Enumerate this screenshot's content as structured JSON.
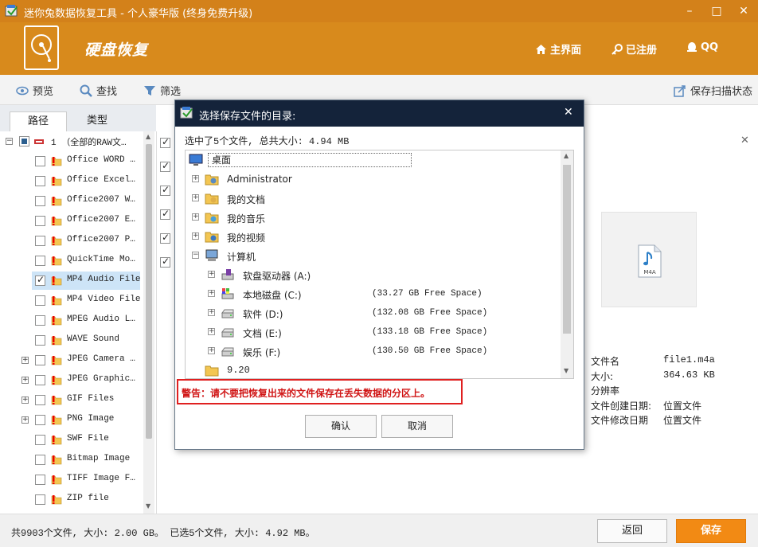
{
  "window": {
    "title": "迷你兔数据恢复工具 - 个人豪华版 (终身免费升级)",
    "minimize": "–",
    "maximize": "□",
    "close": "✕"
  },
  "header": {
    "app_title": "硬盘恢复",
    "nav": {
      "home": "主界面",
      "registered": "已注册",
      "qq": "QQ"
    }
  },
  "toolbar": {
    "preview": "预览",
    "find": "查找",
    "filter": "筛选",
    "save_scan": "保存扫描状态"
  },
  "left_tabs": {
    "path": "路径",
    "type": "类型"
  },
  "tree": {
    "root": "1 （全部的RAW文…",
    "items": [
      {
        "label": "Office WORD …",
        "checked": false,
        "expandable": false
      },
      {
        "label": "Office Excel…",
        "checked": false,
        "expandable": false
      },
      {
        "label": "Office2007 W…",
        "checked": false,
        "expandable": false
      },
      {
        "label": "Office2007 E…",
        "checked": false,
        "expandable": false
      },
      {
        "label": "Office2007 P…",
        "checked": false,
        "expandable": false
      },
      {
        "label": "QuickTime Mo…",
        "checked": false,
        "expandable": false
      },
      {
        "label": "MP4 Audio File",
        "checked": true,
        "expandable": false,
        "selected": true
      },
      {
        "label": "MP4 Video File",
        "checked": false,
        "expandable": false
      },
      {
        "label": "MPEG Audio L…",
        "checked": false,
        "expandable": false
      },
      {
        "label": "WAVE Sound",
        "checked": false,
        "expandable": false
      },
      {
        "label": "JPEG Camera …",
        "checked": false,
        "expandable": true
      },
      {
        "label": "JPEG Graphic…",
        "checked": false,
        "expandable": true
      },
      {
        "label": "GIF Files",
        "checked": false,
        "expandable": true
      },
      {
        "label": "PNG Image",
        "checked": false,
        "expandable": true
      },
      {
        "label": "SWF File",
        "checked": false,
        "expandable": false
      },
      {
        "label": "Bitmap Image",
        "checked": false,
        "expandable": false
      },
      {
        "label": "TIFF Image F…",
        "checked": false,
        "expandable": false
      },
      {
        "label": "ZIP file",
        "checked": false,
        "expandable": false
      }
    ]
  },
  "file_checks": [
    true,
    true,
    true,
    true,
    true,
    true
  ],
  "preview": {
    "badge": "M4A"
  },
  "info": [
    {
      "label": "文件名",
      "value": "file1.m4a"
    },
    {
      "label": "大小:",
      "value": "364.63 KB"
    },
    {
      "label": "分辨率",
      "value": ""
    },
    {
      "label": "文件创建日期:",
      "value": "位置文件"
    },
    {
      "label": "文件修改日期",
      "value": "位置文件"
    }
  ],
  "status": {
    "text": "共9903个文件, 大小: 2.00 GB。 已选5个文件, 大小: 4.92 MB。"
  },
  "bottom": {
    "back": "返回",
    "save": "保存"
  },
  "dialog": {
    "title": "选择保存文件的目录:",
    "close": "✕",
    "summary": "选中了5个文件, 总共大小: 4.94 MB",
    "root": "桌面",
    "folders": [
      {
        "label": "Administrator",
        "icon": "user-folder-icon"
      },
      {
        "label": "我的文档",
        "icon": "documents-folder-icon"
      },
      {
        "label": "我的音乐",
        "icon": "music-folder-icon"
      },
      {
        "label": "我的视频",
        "icon": "video-folder-icon"
      }
    ],
    "computer": "计算机",
    "drives": [
      {
        "label": "软盘驱动器 (A:)",
        "free": "",
        "icon": "floppy-drive-icon"
      },
      {
        "label": "本地磁盘 (C:)",
        "free": "(33.27 GB Free Space)",
        "icon": "system-drive-icon"
      },
      {
        "label": "软件 (D:)",
        "free": "(132.08 GB Free Space)",
        "icon": "hard-drive-icon"
      },
      {
        "label": "文档 (E:)",
        "free": "(133.18 GB Free Space)",
        "icon": "hard-drive-icon"
      },
      {
        "label": "娱乐 (F:)",
        "free": "(130.50 GB Free Space)",
        "icon": "hard-drive-icon"
      }
    ],
    "extra_folder": "9.20",
    "warning": "警告：请不要把恢复出来的文件保存在丢失数据的分区上。",
    "confirm": "确认",
    "cancel": "取消"
  }
}
